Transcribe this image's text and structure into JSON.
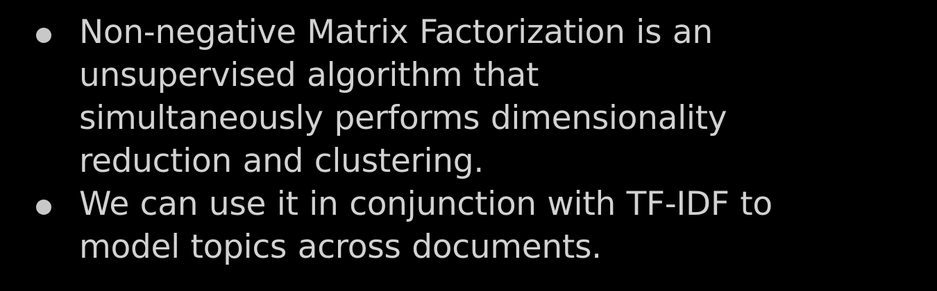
{
  "colors": {
    "background": "#000000",
    "text": "#d2d2d2",
    "bullet": "#c8c8c8"
  },
  "bullets": [
    {
      "lines": [
        "Non-negative Matrix Factorization is an",
        "unsupervised algorithm that",
        "simultaneously performs dimensionality",
        "reduction and clustering."
      ]
    },
    {
      "lines": [
        "We can use it in conjunction with TF-IDF to",
        "model topics across documents."
      ]
    }
  ]
}
